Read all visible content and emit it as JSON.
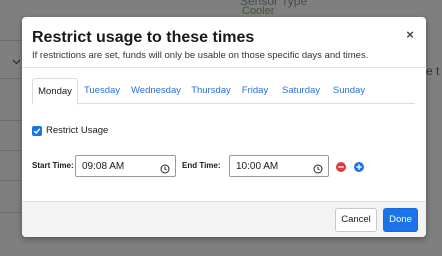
{
  "background": {
    "sensor_type_label": "Sensor Type",
    "sensor_type_value": "Cooler",
    "right_text": "re t"
  },
  "modal": {
    "title": "Restrict usage to these times",
    "subtitle": "If restrictions are set, funds will only be usable on those specific days and times.",
    "close_symbol": "×"
  },
  "tabs": [
    {
      "label": "Monday",
      "active": true
    },
    {
      "label": "Tuesday",
      "active": false
    },
    {
      "label": "Wednesday",
      "active": false
    },
    {
      "label": "Thursday",
      "active": false
    },
    {
      "label": "Friday",
      "active": false
    },
    {
      "label": "Saturday",
      "active": false
    },
    {
      "label": "Sunday",
      "active": false
    }
  ],
  "restrict": {
    "label": "Restrict Usage",
    "checked": true
  },
  "time_range": {
    "start_label": "Start Time:",
    "start_value": "09:08 AM",
    "end_label": "End Time:",
    "end_value": "10:00 AM",
    "remove_icon": "minus-circle-icon",
    "add_icon": "plus-circle-icon"
  },
  "footer": {
    "cancel_label": "Cancel",
    "done_label": "Done"
  },
  "colors": {
    "accent": "#1a73e8",
    "link": "#2a6fd6",
    "remove": "#e0393e",
    "overlay": "#7f7f7f"
  }
}
